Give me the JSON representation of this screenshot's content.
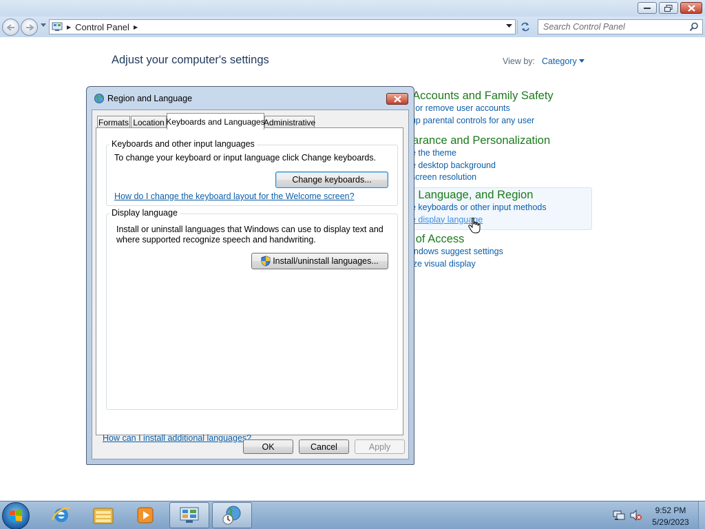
{
  "window": {
    "address_path": "Control Panel",
    "search_placeholder": "Search Control Panel"
  },
  "content": {
    "heading": "Adjust your computer's settings",
    "view_by_label": "View by:",
    "view_by_value": "Category",
    "categories": [
      {
        "title": "r Accounts and Family Safety",
        "links": [
          "ld or remove user accounts",
          "t up parental controls for any user"
        ]
      },
      {
        "title": "earance and Personalization",
        "links": [
          "ge the theme",
          "ge desktop background",
          "t screen resolution"
        ]
      },
      {
        "title": "k, Language, and Region",
        "links": [
          "ge keyboards or other input methods",
          "ge display language"
        ]
      },
      {
        "title": "e of Access",
        "links": [
          "Vindows suggest settings",
          "nize visual display"
        ]
      }
    ]
  },
  "dialog": {
    "title": "Region and Language",
    "tabs": [
      {
        "label": "Formats",
        "active": false
      },
      {
        "label": "Location",
        "active": false
      },
      {
        "label": "Keyboards and Languages",
        "active": true
      },
      {
        "label": "Administrative",
        "active": false
      }
    ],
    "keyboards_group": {
      "label": "Keyboards and other input languages",
      "description": "To change your keyboard or input language click Change keyboards.",
      "button": "Change keyboards...",
      "link": "How do I change the keyboard layout for the Welcome screen?"
    },
    "display_group": {
      "label": "Display language",
      "description_line1": "Install or uninstall languages that Windows can use to display text and",
      "description_line2": "where supported recognize speech and handwriting.",
      "button": "Install/uninstall languages..."
    },
    "install_link": "How can I install additional languages?",
    "buttons": {
      "ok": "OK",
      "cancel": "Cancel",
      "apply": "Apply"
    }
  },
  "taskbar": {
    "time": "9:52 PM",
    "date": "5/29/2023",
    "items": [
      "start-orb",
      "internet-explorer-icon",
      "windows-explorer-icon",
      "media-player-icon",
      "control-panel-icon",
      "region-language-icon"
    ]
  },
  "colors": {
    "link": "#0b5ea8",
    "category_title": "#1c7a1c",
    "heading": "#1e395b",
    "close_button": "#c4412c"
  }
}
